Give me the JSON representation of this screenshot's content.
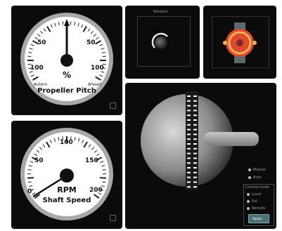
{
  "pitch_gauge": {
    "labels": [
      "50",
      "50",
      "100",
      "100"
    ],
    "unit": "%",
    "title": "Propeller Pitch",
    "left_label": "Astern",
    "right_label": "Ahead",
    "value_percent": 0
  },
  "rpm_gauge": {
    "labels": [
      "100",
      "50",
      "150",
      "0",
      "200"
    ],
    "unit": "RPM",
    "title": "Shaft Speed",
    "value_rpm": 5
  },
  "top_panel_title": "Rotation",
  "controls": {
    "option_a": "Manual",
    "option_b": "Auto",
    "group_title": "Control mode",
    "mode_a": "Local",
    "mode_b": "Ext",
    "mode_c": "Remote",
    "button_label": "Apply"
  },
  "colors": {
    "panel": "#0b0b0b",
    "gauge_face": "#ffffff",
    "needle": "#111111",
    "accent_red": "#e04a2c",
    "button": "#4a6f77"
  }
}
